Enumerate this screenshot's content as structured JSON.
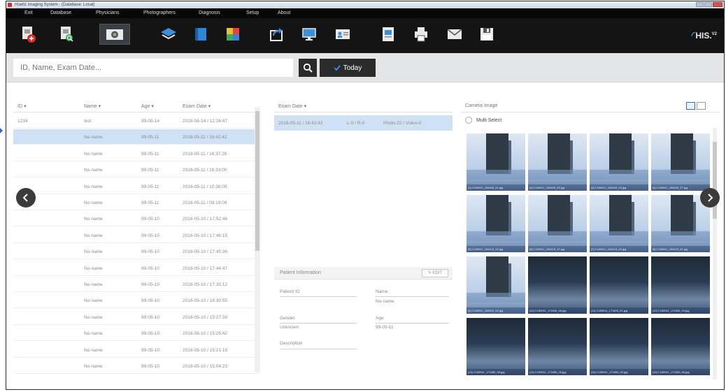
{
  "window": {
    "title": "Hoeltz Imaging System - (Database: Local)"
  },
  "menu": {
    "items": [
      "Exit",
      "Database",
      "Physicians",
      "Photographers",
      "Diagnosis",
      "Setup",
      "About"
    ]
  },
  "toolbar": {
    "buttons": [
      {
        "icon": "add-patient-icon"
      },
      {
        "icon": "search-patient-icon"
      },
      {
        "icon": "camera-icon",
        "active": true
      },
      {
        "icon": "layers-icon"
      },
      {
        "icon": "book-icon"
      },
      {
        "icon": "color-palette-icon"
      },
      {
        "icon": "export-icon"
      },
      {
        "icon": "monitor-icon"
      },
      {
        "icon": "id-card-icon"
      },
      {
        "icon": "report-icon"
      },
      {
        "icon": "printer-icon"
      },
      {
        "icon": "mail-icon"
      },
      {
        "icon": "save-icon"
      }
    ],
    "logo": "HIS.",
    "logo_sup": "V2"
  },
  "search": {
    "placeholder": "ID, Name, Exam Date...",
    "today_label": "Today"
  },
  "patient_list": {
    "headers": {
      "id": "ID  ▾",
      "name": "Name  ▾",
      "age": "Age  ▾",
      "exam_date": "Exam Date  ▾"
    },
    "rows": [
      {
        "id": "1234",
        "name": "test",
        "age": "99-05-14",
        "exam_date": "2018-05-14 / 12:26:47",
        "selected": false
      },
      {
        "id": "",
        "name": "No-name",
        "age": "99-05-11",
        "exam_date": "2018-05-11 / 16:42:42",
        "selected": true
      },
      {
        "id": "",
        "name": "No-name",
        "age": "99-05-11",
        "exam_date": "2018-05-11 / 16:37:26",
        "selected": false
      },
      {
        "id": "",
        "name": "No-name",
        "age": "99-05-11",
        "exam_date": "2018-05-11 / 16:33:00",
        "selected": false
      },
      {
        "id": "",
        "name": "No-name",
        "age": "99-05-11",
        "exam_date": "2018-05-11 / 10:38:09",
        "selected": false
      },
      {
        "id": "",
        "name": "No-name",
        "age": "99-05-11",
        "exam_date": "2018-05-11 / 09:19:09",
        "selected": false
      },
      {
        "id": "",
        "name": "No-name",
        "age": "99-05-10",
        "exam_date": "2018-05-10 / 17:52:46",
        "selected": false
      },
      {
        "id": "",
        "name": "No-name",
        "age": "99-05-10",
        "exam_date": "2018-05-10 / 17:46:15",
        "selected": false
      },
      {
        "id": "",
        "name": "No-name",
        "age": "99-05-10",
        "exam_date": "2018-05-10 / 17:45:36",
        "selected": false
      },
      {
        "id": "",
        "name": "No-name",
        "age": "99-05-10",
        "exam_date": "2018-05-10 / 17:44:47",
        "selected": false
      },
      {
        "id": "",
        "name": "No-name",
        "age": "99-05-10",
        "exam_date": "2018-05-10 / 17:35:12",
        "selected": false
      },
      {
        "id": "",
        "name": "No-name",
        "age": "99-05-10",
        "exam_date": "2018-05-10 / 16:30:55",
        "selected": false
      },
      {
        "id": "",
        "name": "No-name",
        "age": "99-05-10",
        "exam_date": "2018-05-10 / 15:27:39",
        "selected": false
      },
      {
        "id": "",
        "name": "No-name",
        "age": "99-05-10",
        "exam_date": "2018-05-10 / 15:25:42",
        "selected": false
      },
      {
        "id": "",
        "name": "No-name",
        "age": "99-05-10",
        "exam_date": "2018-05-10 / 15:21:19",
        "selected": false
      },
      {
        "id": "",
        "name": "No-name",
        "age": "99-05-10",
        "exam_date": "2018-05-10 / 15:04:23",
        "selected": false
      }
    ]
  },
  "exam_list": {
    "header": "Exam Date  ▾",
    "rows": [
      {
        "date": "2018-05-11 / 16:42:42",
        "lr": "L-0 / R-0",
        "media": "Photo-22 / Video-0"
      }
    ]
  },
  "patient_info": {
    "title": "Patient Information",
    "edit_label": "EDIT",
    "patient_id_label": "Patient ID",
    "patient_id_value": "",
    "name_label": "Name",
    "name_value": "No-name",
    "gender_label": "Gender",
    "gender_value": "Unknown",
    "age_label": "Age",
    "age_value": "99-05-11",
    "description_label": "Description",
    "description_value": ""
  },
  "camera": {
    "title": "Camera Image",
    "multi_select_label": "Multi Select",
    "images": [
      {
        "label": "[1] C180511_163406_01.jpg",
        "style": "building"
      },
      {
        "label": "[2] C180511_163409_09.jpg",
        "style": "building"
      },
      {
        "label": "[3] C180511_163409_15.jpg",
        "style": "building"
      },
      {
        "label": "[4] C180511_163409_27.jpg",
        "style": "building"
      },
      {
        "label": "[5] C180511_163415_32.jpg",
        "style": "building"
      },
      {
        "label": "[6] C180511_163415_37.jpg",
        "style": "building"
      },
      {
        "label": "[7] C180511_163415_45.jpg",
        "style": "building"
      },
      {
        "label": "[8] C180511_163415_51.jpg",
        "style": "building"
      },
      {
        "label": "[9] C180511_163420_02.jpg",
        "style": "building"
      },
      {
        "label": "[10] C180511_171840_08.jpg",
        "style": "dark"
      },
      {
        "label": "[11] C180511_171840_61.jpg",
        "style": "dark"
      },
      {
        "label": "[12] C180511_171840_25.jpg",
        "style": "dark"
      },
      {
        "label": "[13] C180511_171850_05.jpg",
        "style": "dark"
      },
      {
        "label": "[14] C180511_171850_26.jpg",
        "style": "dark"
      },
      {
        "label": "[15] C180511_171850_52.jpg",
        "style": "dark"
      },
      {
        "label": "[16] C180511_171850_66.jpg",
        "style": "dark"
      }
    ]
  }
}
